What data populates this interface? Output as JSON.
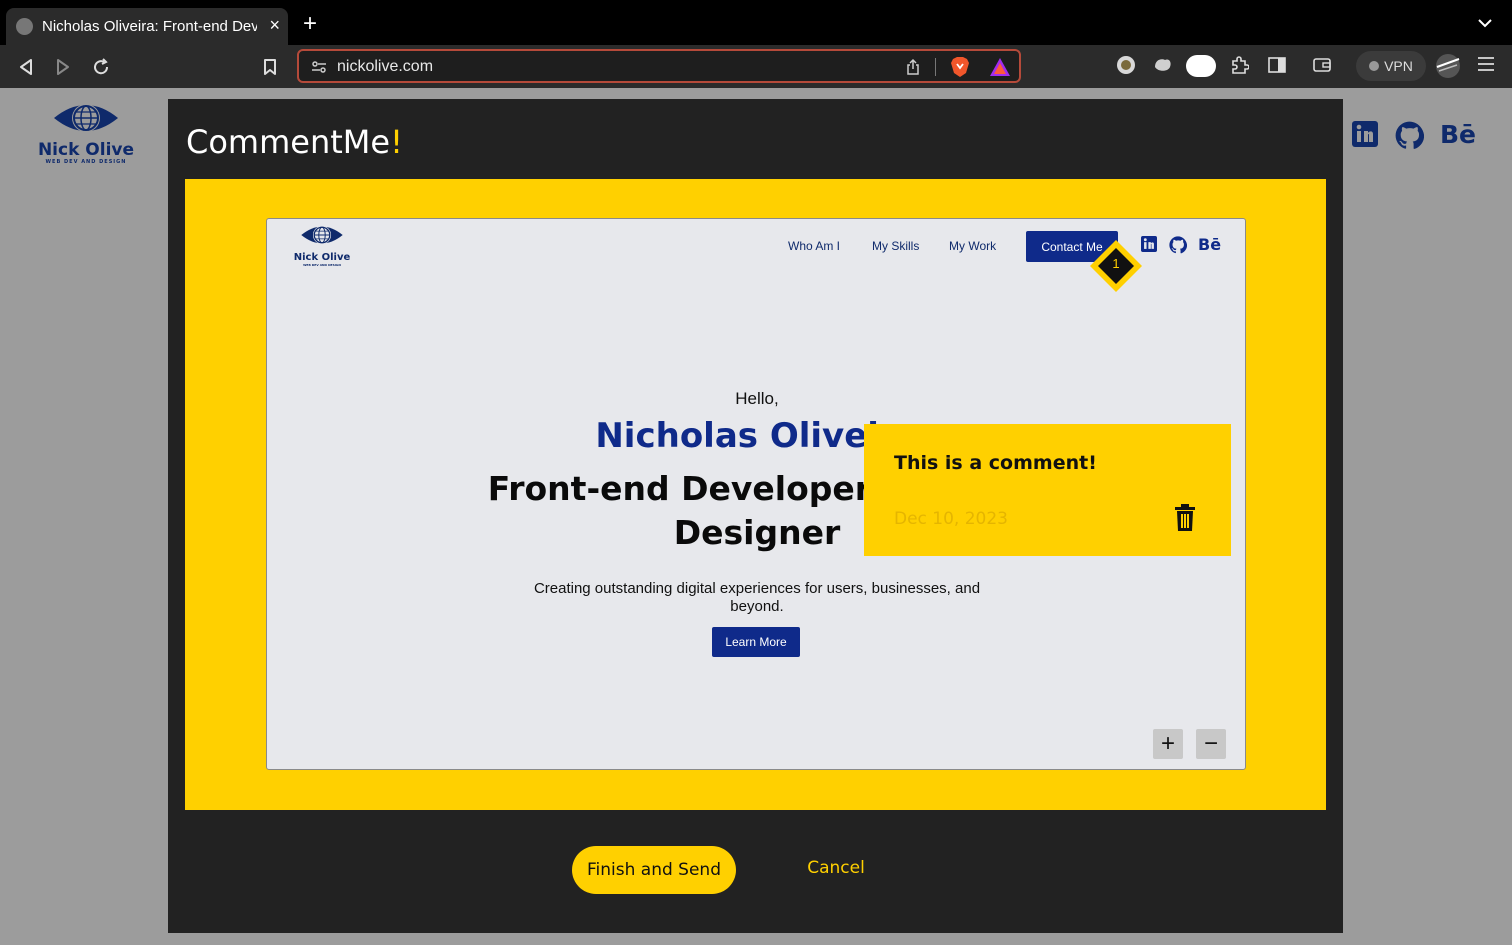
{
  "browser": {
    "tab_title": "Nicholas Oliveira: Front-end Developer & UX/UI Designer",
    "tab_close": "×",
    "new_tab": "+",
    "url": "nickolive.com",
    "vpn_label": "VPN"
  },
  "background_site": {
    "logo_name": "Nick Olive",
    "logo_tagline": "WEB DEV AND DESIGN",
    "social": [
      "linkedin-icon",
      "github-icon",
      "behance-icon"
    ]
  },
  "modal": {
    "title": "CommentMe",
    "title_accent": "!",
    "finish_label": "Finish and Send",
    "cancel_label": "Cancel",
    "accent_color": "#ffd000"
  },
  "preview_site": {
    "logo_name": "Nick Olive",
    "logo_tagline": "WEB DEV AND DESIGN",
    "nav": [
      "Who Am I",
      "My Skills",
      "My Work"
    ],
    "contact_label": "Contact Me",
    "behance_label": "Bē",
    "hero_hello": "Hello,",
    "hero_name": "Nicholas Oliveira",
    "hero_role": "Front-end Developer & UX/UI Designer",
    "hero_desc": "Creating outstanding digital experiences for users, businesses, and beyond.",
    "learn_more": "Learn More",
    "brand_color": "#0f2a8a"
  },
  "comment": {
    "number": "1",
    "text": "This is a comment!",
    "date": "Dec 10, 2023"
  },
  "zoom": {
    "in_label": "+",
    "out_label": "−"
  }
}
